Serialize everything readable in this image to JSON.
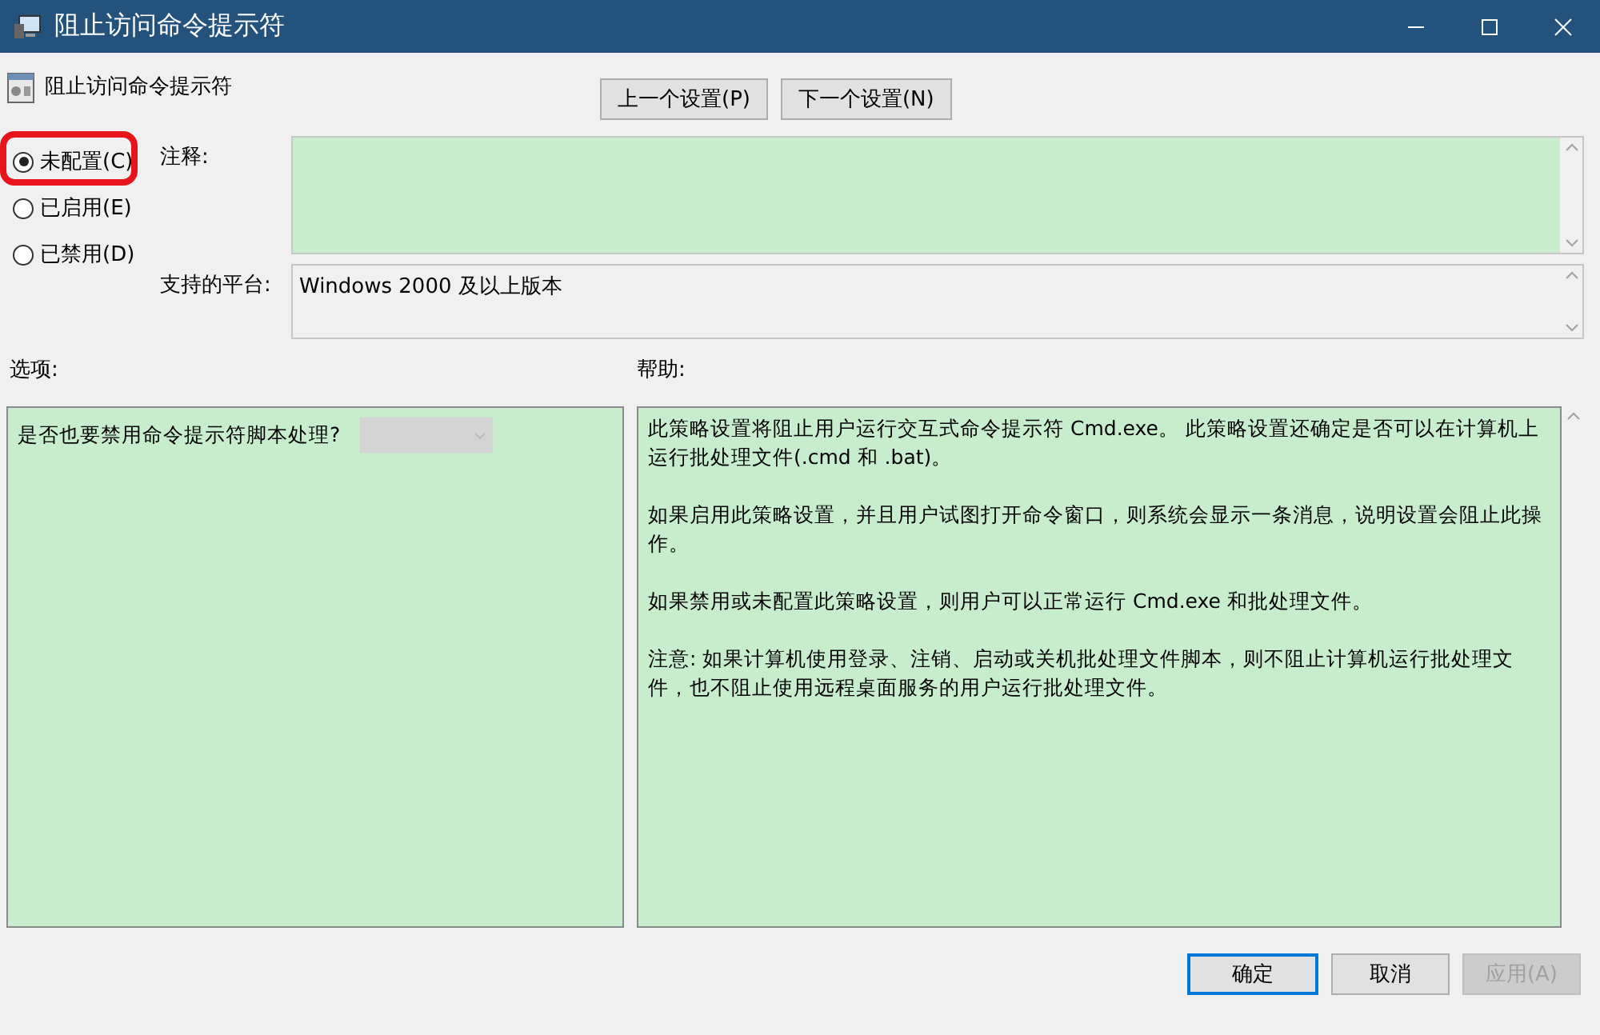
{
  "window": {
    "title": "阻止访问命令提示符"
  },
  "header": {
    "title": "阻止访问命令提示符"
  },
  "nav_buttons": [
    {
      "label": "上一个设置(P)"
    },
    {
      "label": "下一个设置(N)"
    }
  ],
  "radios": [
    {
      "label": "未配置(C)",
      "selected": true,
      "highlighted": true
    },
    {
      "label": "已启用(E)",
      "selected": false,
      "highlighted": false
    },
    {
      "label": "已禁用(D)",
      "selected": false,
      "highlighted": false
    }
  ],
  "comment": {
    "label": "注释:"
  },
  "platform": {
    "label": "支持的平台:",
    "value": "Windows 2000 及以上版本"
  },
  "options": {
    "label": "选项:",
    "items": [
      {
        "text": "是否也要禁用命令提示符脚本处理?",
        "disabled": true
      }
    ]
  },
  "help": {
    "label": "帮助:",
    "paragraphs": [
      "此策略设置将阻止用户运行交互式命令提示符 Cmd.exe。 此策略设置还确定是否可以在计算机上运行批处理文件(.cmd 和 .bat)。",
      "如果启用此策略设置，并且用户试图打开命令窗口，则系统会显示一条消息，说明设置会阻止此操作。",
      "如果禁用或未配置此策略设置，则用户可以正常运行 Cmd.exe 和批处理文件。",
      "注意: 如果计算机使用登录、注销、启动或关机批处理文件脚本，则不阻止计算机运行批处理文件，也不阻止使用远程桌面服务的用户运行批处理文件。"
    ]
  },
  "buttons": [
    {
      "label": "确定",
      "kind": "default",
      "disabled": false
    },
    {
      "label": "取消",
      "kind": "normal",
      "disabled": false
    },
    {
      "label": "应用(A)",
      "kind": "normal",
      "disabled": true
    }
  ]
}
